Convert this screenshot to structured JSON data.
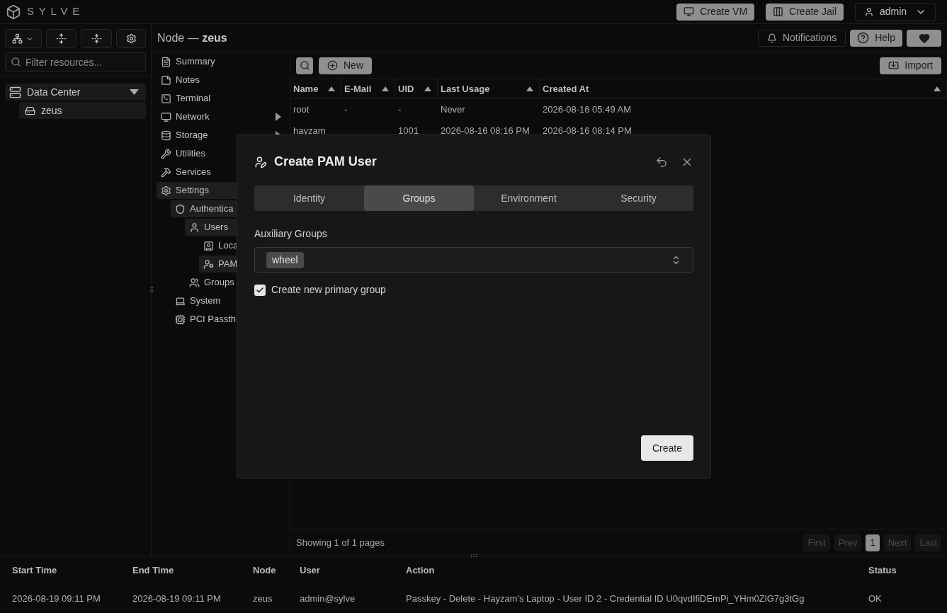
{
  "app": {
    "logo": "SYLVE"
  },
  "topbar": {
    "buttons": [
      "Create VM",
      "Create Jail"
    ],
    "user": "admin"
  },
  "sidebar": {
    "filter_placeholder": "Filter resources...",
    "tree": [
      {
        "label": "Data Center",
        "expanded": true,
        "children": [
          {
            "label": "zeus",
            "selected": true
          }
        ]
      }
    ]
  },
  "header": {
    "node_prefix": "Node — ",
    "node": "zeus",
    "notifications": "Notifications",
    "help": "Help"
  },
  "nav": [
    {
      "label": "Summary"
    },
    {
      "label": "Notes"
    },
    {
      "label": "Terminal"
    },
    {
      "label": "Network",
      "expanded": false
    },
    {
      "label": "Storage",
      "expanded": false
    },
    {
      "label": "Utilities"
    },
    {
      "label": "Services"
    },
    {
      "label": "Settings",
      "expanded": true,
      "children": [
        {
          "label": "Authentica",
          "expanded": true,
          "children": [
            {
              "label": "Users",
              "expanded": true,
              "children": [
                {
                  "label": "Loca",
                  "selected": false
                },
                {
                  "label": "PAM",
                  "selected": true
                }
              ]
            },
            {
              "label": "Groups"
            }
          ]
        },
        {
          "label": "System"
        },
        {
          "label": "PCI Passth"
        }
      ]
    }
  ],
  "toolbar": {
    "new": "New",
    "import": "Import"
  },
  "table": {
    "columns": [
      "Name",
      "E-Mail",
      "UID",
      "Last Usage",
      "Created At"
    ],
    "rows": [
      [
        "root",
        "-",
        "-",
        "Never",
        "2026-08-16 05:49 AM"
      ],
      [
        "hayzam",
        "",
        "1001",
        "2026-08-16 08:16 PM",
        "2026-08-16 08:14 PM"
      ]
    ]
  },
  "pagination": {
    "summary": "Showing 1 of 1 pages",
    "controls": [
      {
        "label": "First",
        "disabled": true
      },
      {
        "label": "Prev",
        "disabled": true
      },
      {
        "label": "1",
        "selected": true
      },
      {
        "label": "Next",
        "disabled": true
      },
      {
        "label": "Last",
        "disabled": true
      }
    ]
  },
  "dialog": {
    "title": "Create PAM User",
    "tabs": [
      {
        "label": "Identity",
        "selected": false
      },
      {
        "label": "Groups",
        "selected": true
      },
      {
        "label": "Environment",
        "selected": false
      },
      {
        "label": "Security",
        "selected": false
      }
    ],
    "groups_label": "Auxiliary Groups",
    "groups": [
      "wheel"
    ],
    "primary_group": {
      "label": "Create new primary group",
      "checked": true
    },
    "submit": "Create"
  },
  "audit": {
    "columns": [
      "Start Time",
      "End Time",
      "Node",
      "User",
      "Action",
      "Status"
    ],
    "rows": [
      [
        "2026-08-19 09:11 PM",
        "2026-08-19 09:11 PM",
        "zeus",
        "admin@sylve",
        "Passkey - Delete - Hayzam's Laptop - User ID 2 - Credential ID U0qvdIfiDEmPi_YHm0ZlG7g3tGg",
        "OK"
      ]
    ]
  }
}
